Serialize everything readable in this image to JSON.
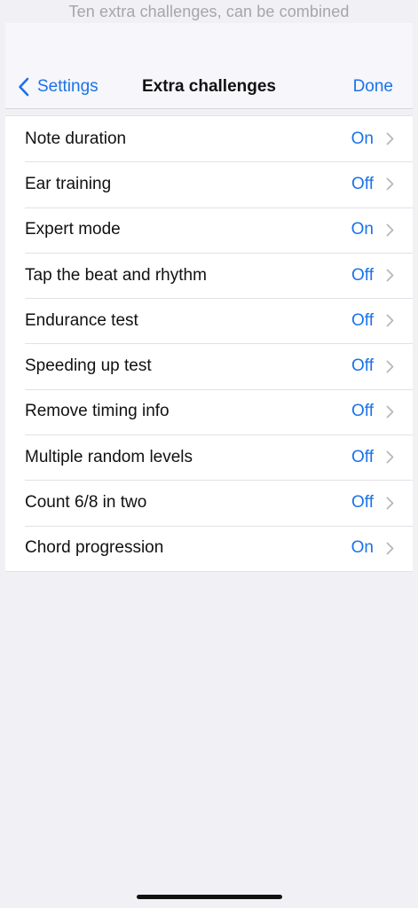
{
  "top_hint": "Ten extra challenges, can be combined",
  "nav": {
    "back_label": "Settings",
    "title": "Extra challenges",
    "done_label": "Done"
  },
  "rows": [
    {
      "label": "Note duration",
      "value": "On"
    },
    {
      "label": "Ear training",
      "value": "Off"
    },
    {
      "label": "Expert mode",
      "value": "On"
    },
    {
      "label": "Tap the beat and rhythm",
      "value": "Off"
    },
    {
      "label": "Endurance test",
      "value": "Off"
    },
    {
      "label": "Speeding up test",
      "value": "Off"
    },
    {
      "label": "Remove timing info",
      "value": "Off"
    },
    {
      "label": "Multiple random levels",
      "value": "Off"
    },
    {
      "label": "Count 6/8 in two",
      "value": "Off"
    },
    {
      "label": "Chord progression",
      "value": "On"
    }
  ],
  "icons": {
    "back": "chevron-left-icon",
    "row": "chevron-right-icon"
  },
  "colors": {
    "accent": "#1a73e8",
    "background": "#f1f0f5",
    "list_background": "#ffffff",
    "separator": "#e2e1e6"
  }
}
